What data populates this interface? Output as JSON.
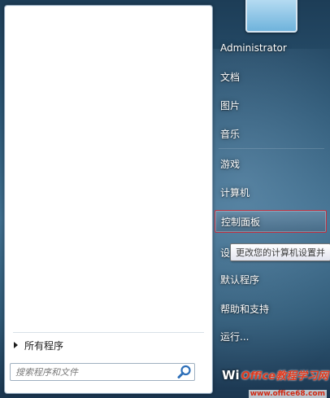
{
  "start_menu": {
    "all_programs_label": "所有程序",
    "search": {
      "placeholder": "搜索程序和文件"
    },
    "right_items": [
      {
        "label": "Administrator",
        "name": "user-name"
      },
      {
        "label": "文档",
        "name": "menu-item-documents"
      },
      {
        "label": "图片",
        "name": "menu-item-pictures"
      },
      {
        "label": "音乐",
        "name": "menu-item-music"
      },
      {
        "label": "游戏",
        "name": "menu-item-games"
      },
      {
        "label": "计算机",
        "name": "menu-item-computer"
      },
      {
        "label": "控制面板",
        "name": "menu-item-control-panel"
      },
      {
        "label": "设",
        "name": "menu-item-devices"
      },
      {
        "label": "默认程序",
        "name": "menu-item-default-programs"
      },
      {
        "label": "帮助和支持",
        "name": "menu-item-help"
      },
      {
        "label": "运行...",
        "name": "menu-item-run"
      }
    ],
    "tooltip": "更改您的计算机设置并",
    "highlight_color": "#c03040"
  },
  "watermark": {
    "prefix": "Wi",
    "brand": "Office教程学习网",
    "url": "www.office68.com"
  },
  "icons": {
    "search": "search-icon",
    "arrow": "right-arrow-icon",
    "user_picture": "user-picture"
  }
}
